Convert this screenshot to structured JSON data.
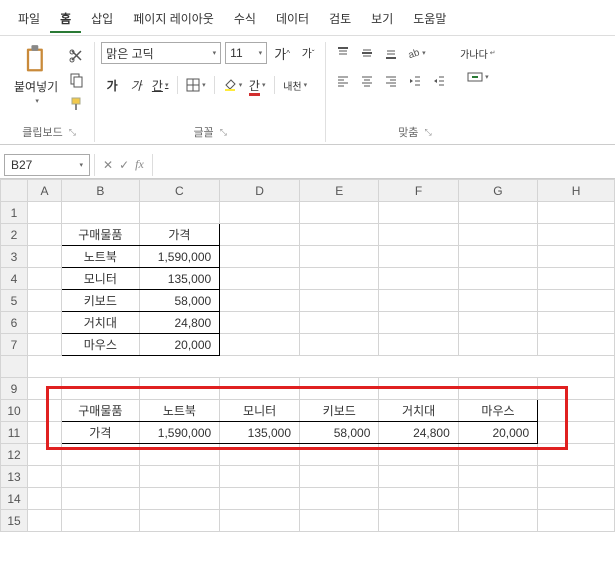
{
  "menu": {
    "items": [
      "파일",
      "홈",
      "삽입",
      "페이지 레이아웃",
      "수식",
      "데이터",
      "검토",
      "보기",
      "도움말"
    ],
    "active": 1
  },
  "ribbon": {
    "clipboard": {
      "paste": "붙여넣기",
      "label": "클립보드"
    },
    "font": {
      "name": "맑은 고딕",
      "size": "11",
      "label": "글꼴",
      "bold": "가",
      "italic": "가",
      "underline": "간",
      "ruby": "내천"
    },
    "align": {
      "label": "맞춤",
      "wrap": "가나다"
    }
  },
  "formula": {
    "cell": "B27"
  },
  "table1": {
    "headers": [
      "구매물품",
      "가격"
    ],
    "rows": [
      [
        "노트북",
        "1,590,000"
      ],
      [
        "모니터",
        "135,000"
      ],
      [
        "키보드",
        "58,000"
      ],
      [
        "거치대",
        "24,800"
      ],
      [
        "마우스",
        "20,000"
      ]
    ]
  },
  "table2": {
    "rowHeaders": [
      "구매물품",
      "가격"
    ],
    "cols": [
      "노트북",
      "모니터",
      "키보드",
      "거치대",
      "마우스"
    ],
    "vals": [
      "1,590,000",
      "135,000",
      "58,000",
      "24,800",
      "20,000"
    ]
  },
  "cols": [
    "A",
    "B",
    "C",
    "D",
    "E",
    "F",
    "G",
    "H"
  ]
}
